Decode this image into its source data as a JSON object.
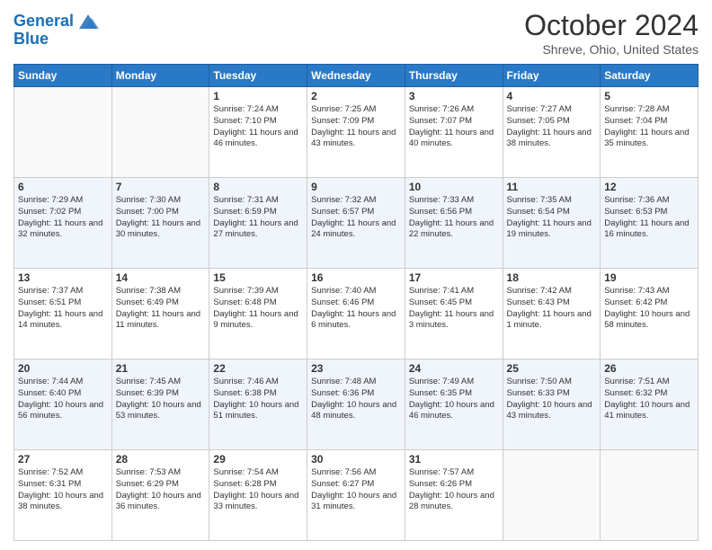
{
  "header": {
    "logo_line1": "General",
    "logo_line2": "Blue",
    "month_title": "October 2024",
    "subtitle": "Shreve, Ohio, United States"
  },
  "days_of_week": [
    "Sunday",
    "Monday",
    "Tuesday",
    "Wednesday",
    "Thursday",
    "Friday",
    "Saturday"
  ],
  "weeks": [
    [
      {
        "day": "",
        "detail": ""
      },
      {
        "day": "",
        "detail": ""
      },
      {
        "day": "1",
        "detail": "Sunrise: 7:24 AM\nSunset: 7:10 PM\nDaylight: 11 hours and 46 minutes."
      },
      {
        "day": "2",
        "detail": "Sunrise: 7:25 AM\nSunset: 7:09 PM\nDaylight: 11 hours and 43 minutes."
      },
      {
        "day": "3",
        "detail": "Sunrise: 7:26 AM\nSunset: 7:07 PM\nDaylight: 11 hours and 40 minutes."
      },
      {
        "day": "4",
        "detail": "Sunrise: 7:27 AM\nSunset: 7:05 PM\nDaylight: 11 hours and 38 minutes."
      },
      {
        "day": "5",
        "detail": "Sunrise: 7:28 AM\nSunset: 7:04 PM\nDaylight: 11 hours and 35 minutes."
      }
    ],
    [
      {
        "day": "6",
        "detail": "Sunrise: 7:29 AM\nSunset: 7:02 PM\nDaylight: 11 hours and 32 minutes."
      },
      {
        "day": "7",
        "detail": "Sunrise: 7:30 AM\nSunset: 7:00 PM\nDaylight: 11 hours and 30 minutes."
      },
      {
        "day": "8",
        "detail": "Sunrise: 7:31 AM\nSunset: 6:59 PM\nDaylight: 11 hours and 27 minutes."
      },
      {
        "day": "9",
        "detail": "Sunrise: 7:32 AM\nSunset: 6:57 PM\nDaylight: 11 hours and 24 minutes."
      },
      {
        "day": "10",
        "detail": "Sunrise: 7:33 AM\nSunset: 6:56 PM\nDaylight: 11 hours and 22 minutes."
      },
      {
        "day": "11",
        "detail": "Sunrise: 7:35 AM\nSunset: 6:54 PM\nDaylight: 11 hours and 19 minutes."
      },
      {
        "day": "12",
        "detail": "Sunrise: 7:36 AM\nSunset: 6:53 PM\nDaylight: 11 hours and 16 minutes."
      }
    ],
    [
      {
        "day": "13",
        "detail": "Sunrise: 7:37 AM\nSunset: 6:51 PM\nDaylight: 11 hours and 14 minutes."
      },
      {
        "day": "14",
        "detail": "Sunrise: 7:38 AM\nSunset: 6:49 PM\nDaylight: 11 hours and 11 minutes."
      },
      {
        "day": "15",
        "detail": "Sunrise: 7:39 AM\nSunset: 6:48 PM\nDaylight: 11 hours and 9 minutes."
      },
      {
        "day": "16",
        "detail": "Sunrise: 7:40 AM\nSunset: 6:46 PM\nDaylight: 11 hours and 6 minutes."
      },
      {
        "day": "17",
        "detail": "Sunrise: 7:41 AM\nSunset: 6:45 PM\nDaylight: 11 hours and 3 minutes."
      },
      {
        "day": "18",
        "detail": "Sunrise: 7:42 AM\nSunset: 6:43 PM\nDaylight: 11 hours and 1 minute."
      },
      {
        "day": "19",
        "detail": "Sunrise: 7:43 AM\nSunset: 6:42 PM\nDaylight: 10 hours and 58 minutes."
      }
    ],
    [
      {
        "day": "20",
        "detail": "Sunrise: 7:44 AM\nSunset: 6:40 PM\nDaylight: 10 hours and 56 minutes."
      },
      {
        "day": "21",
        "detail": "Sunrise: 7:45 AM\nSunset: 6:39 PM\nDaylight: 10 hours and 53 minutes."
      },
      {
        "day": "22",
        "detail": "Sunrise: 7:46 AM\nSunset: 6:38 PM\nDaylight: 10 hours and 51 minutes."
      },
      {
        "day": "23",
        "detail": "Sunrise: 7:48 AM\nSunset: 6:36 PM\nDaylight: 10 hours and 48 minutes."
      },
      {
        "day": "24",
        "detail": "Sunrise: 7:49 AM\nSunset: 6:35 PM\nDaylight: 10 hours and 46 minutes."
      },
      {
        "day": "25",
        "detail": "Sunrise: 7:50 AM\nSunset: 6:33 PM\nDaylight: 10 hours and 43 minutes."
      },
      {
        "day": "26",
        "detail": "Sunrise: 7:51 AM\nSunset: 6:32 PM\nDaylight: 10 hours and 41 minutes."
      }
    ],
    [
      {
        "day": "27",
        "detail": "Sunrise: 7:52 AM\nSunset: 6:31 PM\nDaylight: 10 hours and 38 minutes."
      },
      {
        "day": "28",
        "detail": "Sunrise: 7:53 AM\nSunset: 6:29 PM\nDaylight: 10 hours and 36 minutes."
      },
      {
        "day": "29",
        "detail": "Sunrise: 7:54 AM\nSunset: 6:28 PM\nDaylight: 10 hours and 33 minutes."
      },
      {
        "day": "30",
        "detail": "Sunrise: 7:56 AM\nSunset: 6:27 PM\nDaylight: 10 hours and 31 minutes."
      },
      {
        "day": "31",
        "detail": "Sunrise: 7:57 AM\nSunset: 6:26 PM\nDaylight: 10 hours and 28 minutes."
      },
      {
        "day": "",
        "detail": ""
      },
      {
        "day": "",
        "detail": ""
      }
    ]
  ]
}
